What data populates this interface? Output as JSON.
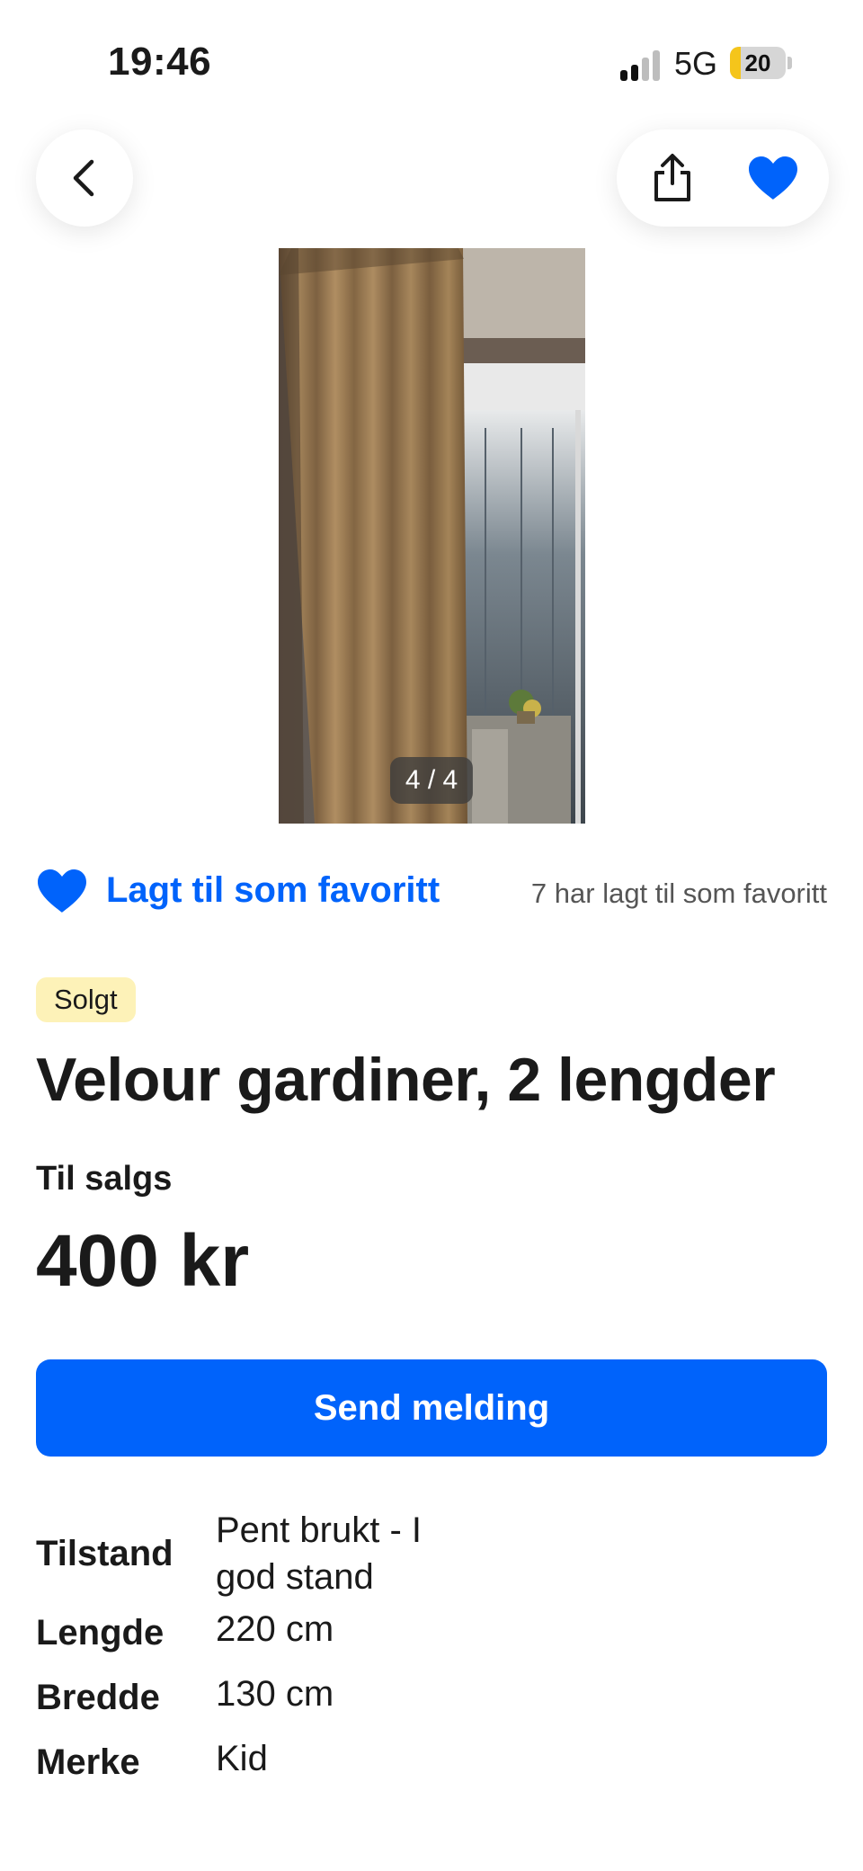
{
  "status_bar": {
    "time": "19:46",
    "network": "5G",
    "battery": "20",
    "battery_level": 0.2
  },
  "top_bar": {
    "back_icon": "chevron-left-icon",
    "share_icon": "share-icon",
    "favorite_icon": "heart-filled-icon"
  },
  "gallery": {
    "counter": "4 / 4"
  },
  "favorite": {
    "label": "Lagt til som favoritt",
    "count_text": "7 har lagt til som favoritt"
  },
  "listing": {
    "status_badge": "Solgt",
    "title": "Velour gardiner, 2 lengder",
    "sale_type": "Til salgs",
    "price": "400 kr"
  },
  "actions": {
    "send_message": "Send melding"
  },
  "specs": [
    {
      "key": "Tilstand",
      "value": "Pent brukt - I god stand"
    },
    {
      "key": "Lengde",
      "value": "220 cm"
    },
    {
      "key": "Bredde",
      "value": "130 cm"
    },
    {
      "key": "Merke",
      "value": "Kid"
    }
  ],
  "colors": {
    "accent": "#0063fb",
    "badge_bg": "#fdf2b8",
    "text": "#1a1a1a"
  }
}
